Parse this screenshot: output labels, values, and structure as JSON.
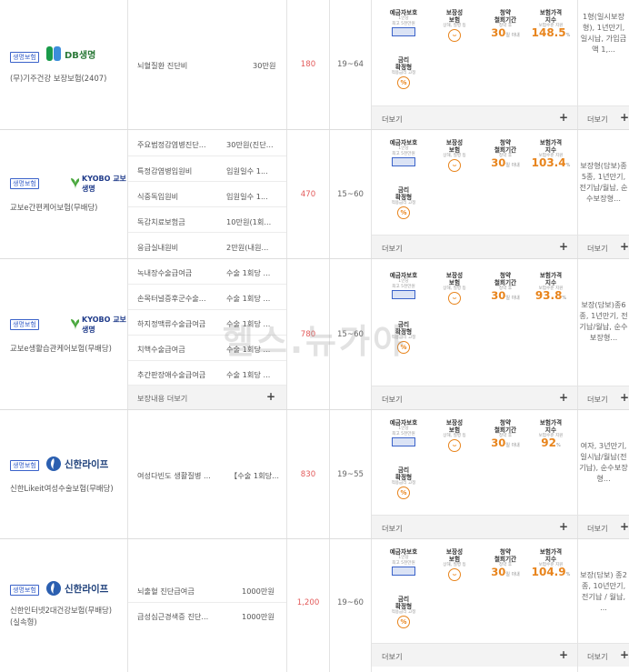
{
  "common": {
    "badge": "생명보험",
    "more": "더보기",
    "more_short": "더보기",
    "plus": "+",
    "feature_labels": {
      "protect": "예금자보호",
      "protect_sub1": "1인당",
      "protect_sub2": "최고 5천만원",
      "guarantee": "보장성\n보험",
      "guarantee_sub": "상해, 질병 등",
      "cancel": "청약\n철회기간",
      "cancel_sub": "청약 후",
      "cancel_value": "30",
      "cancel_unit": "일 이내",
      "index": "보험가격\n지수",
      "index_sub": "보험수준 지원",
      "rate": "금리\n확정형",
      "rate_sub": "적용금리 고정"
    }
  },
  "products": [
    {
      "logo_text": "DB생명",
      "name": [
        "(무)기주건강 보장보험(2407)"
      ],
      "items": [
        {
          "name": "뇌혈질환 진단비",
          "amount": "30만원"
        }
      ],
      "premium": "180",
      "age": "19~64",
      "index_value": "148.5",
      "index_unit": "%",
      "desc": "1형(일시보장형), 1년만기, 일시납, 가입금액 1,..."
    },
    {
      "logo_text": "KYOBO 교보생명",
      "name": [
        "교보e간편케어보험(무배당)"
      ],
      "items": [
        {
          "name": "주요범정감염병진단...",
          "amount": "30만원(진단..."
        },
        {
          "name": "특정감염병입원비",
          "amount": "입원일수 1..."
        },
        {
          "name": "식중독입원비",
          "amount": "입원일수 1..."
        },
        {
          "name": "독감치료보험금",
          "amount": "10만원(1회..."
        },
        {
          "name": "응급실내원비",
          "amount": "2만원(내원..."
        }
      ],
      "premium": "470",
      "age": "15~60",
      "index_value": "103.4",
      "index_unit": "%",
      "desc": "보장형(담보)종5종, 1년만기, 전기납/월납, 순수보장형..."
    },
    {
      "logo_text": "KYOBO 교보생명",
      "name": [
        "교보e생활습관케어보험(무배당)"
      ],
      "items": [
        {
          "name": "녹내장수술급여금",
          "amount": "수술 1회당 ..."
        },
        {
          "name": "손목터널증후군수술...",
          "amount": "수술 1회당 ..."
        },
        {
          "name": "하지정맥류수술급여금",
          "amount": "수술 1회당 ..."
        },
        {
          "name": "치핵수술급여금",
          "amount": "수술 1회당 ..."
        },
        {
          "name": "추간판장애수술급여금",
          "amount": "수술 1회당 ..."
        }
      ],
      "items_more": "보장내용 더보기",
      "premium": "780",
      "age": "15~60",
      "index_value": "93.8",
      "index_unit": "%",
      "desc": "보장(담보)종6종, 1년만기, 전기납/월납, 순수보장형..."
    },
    {
      "logo_text": "신한라이프",
      "name": [
        "신한Likeit여성수술보험(무배당)"
      ],
      "items": [
        {
          "name": "여성다빈도 생활질병 ...",
          "amount": "【수술 1회당..."
        }
      ],
      "premium": "830",
      "age": "19~55",
      "index_value": "92",
      "index_unit": "%",
      "desc": "여자, 3년만기, 일시납/월납(전기납), 순수보장형..."
    },
    {
      "logo_text": "신한라이프",
      "name": [
        "신한인터넷2대건강보험(무배당)",
        "(실속형)"
      ],
      "items": [
        {
          "name": "뇌출혈 진단급여금",
          "amount": "1000만원"
        },
        {
          "name": "급성심근경색증 진단...",
          "amount": "1000만원"
        }
      ],
      "premium": "1,200",
      "age": "19~60",
      "index_value": "104.9",
      "index_unit": "%",
      "desc": "보장(담보) 종2종, 10년만기, 전기납 / 월납, ..."
    }
  ],
  "watermark": "헬스.뉴가야"
}
